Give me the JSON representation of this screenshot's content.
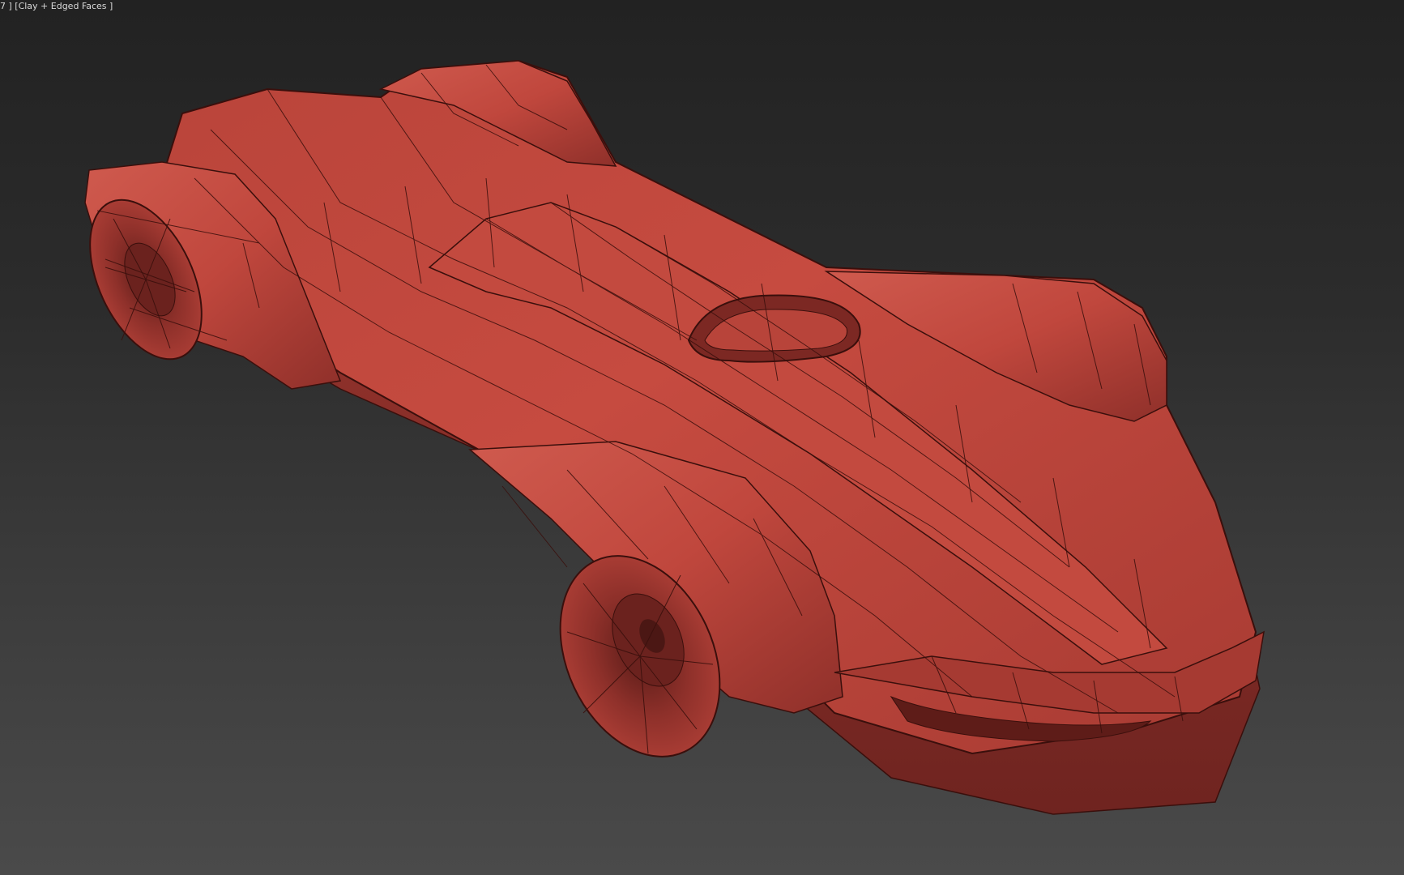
{
  "viewport": {
    "label": "7 ] [Clay + Edged Faces ]",
    "background_top": "#222222",
    "background_bottom": "#4a4a4a"
  },
  "model": {
    "icon": "car-3d-model",
    "clay_color": "#c2493e",
    "edge_color": "#3a0f0c"
  }
}
